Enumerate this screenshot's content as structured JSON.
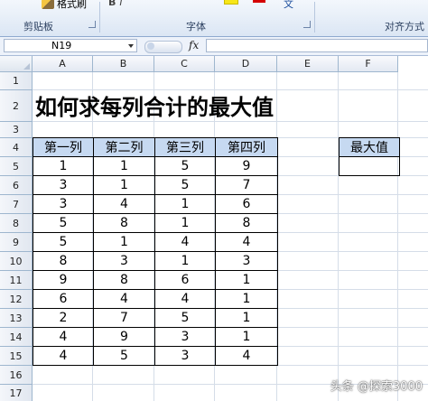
{
  "ribbon": {
    "format_painter_label": "格式刷",
    "bold_label": "B",
    "italic_label": "I",
    "wrap_label": "文",
    "groups": [
      "剪贴板",
      "字体",
      "对齐方式"
    ]
  },
  "formula_bar": {
    "name_box": "N19",
    "fx_label": "fx",
    "formula": ""
  },
  "columns": [
    "A",
    "B",
    "C",
    "D",
    "E",
    "F"
  ],
  "rows": [
    "1",
    "2",
    "3",
    "4",
    "5",
    "6",
    "7",
    "8",
    "9",
    "10",
    "11",
    "12",
    "13",
    "14",
    "15",
    "16",
    "17"
  ],
  "title": "如何求每列合计的最大值",
  "table": {
    "headers": [
      "第一列",
      "第二列",
      "第三列",
      "第四列"
    ],
    "rows": [
      [
        "1",
        "1",
        "5",
        "9"
      ],
      [
        "3",
        "1",
        "5",
        "7"
      ],
      [
        "3",
        "4",
        "1",
        "6"
      ],
      [
        "5",
        "8",
        "1",
        "8"
      ],
      [
        "5",
        "1",
        "4",
        "4"
      ],
      [
        "8",
        "3",
        "1",
        "3"
      ],
      [
        "9",
        "8",
        "6",
        "1"
      ],
      [
        "6",
        "4",
        "4",
        "1"
      ],
      [
        "2",
        "7",
        "5",
        "1"
      ],
      [
        "4",
        "9",
        "3",
        "1"
      ],
      [
        "4",
        "5",
        "3",
        "4"
      ]
    ]
  },
  "max_box": {
    "header": "最大值",
    "value": ""
  },
  "watermark": "头条 @探索3000",
  "colors": {
    "header_fill": "#c6d9f1",
    "ribbon_bg": "#dbe6f4",
    "grid_line": "#d5dde8"
  }
}
